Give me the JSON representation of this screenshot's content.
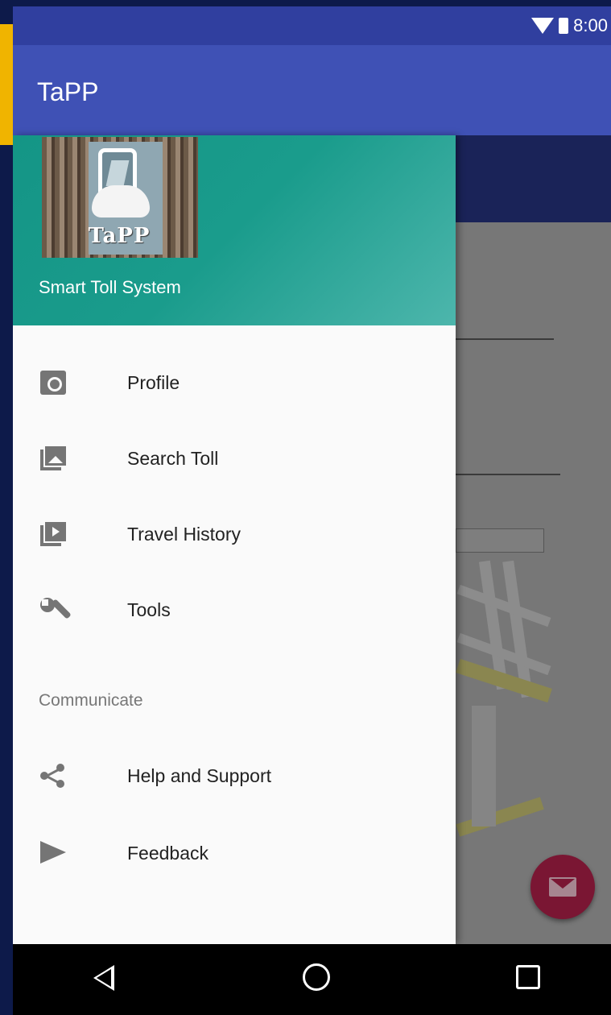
{
  "status_bar": {
    "time": "8:00"
  },
  "app_bar": {
    "title": "TaPP"
  },
  "drawer": {
    "logo_text": "TaPP",
    "subtitle": "Smart Toll System",
    "items": [
      {
        "label": "Profile",
        "icon": "camera-icon"
      },
      {
        "label": "Search Toll",
        "icon": "photo-library-icon"
      },
      {
        "label": "Travel History",
        "icon": "video-library-icon"
      },
      {
        "label": "Tools",
        "icon": "wrench-icon"
      }
    ],
    "section_label": "Communicate",
    "section_items": [
      {
        "label": "Help and Support",
        "icon": "share-icon"
      },
      {
        "label": "Feedback",
        "icon": "send-icon"
      }
    ]
  },
  "fab": {
    "icon": "email-icon"
  },
  "colors": {
    "primary": "#3f51b5",
    "primary_dark": "#303f9f",
    "drawer_header": "#149586",
    "accent": "#7a1633"
  }
}
